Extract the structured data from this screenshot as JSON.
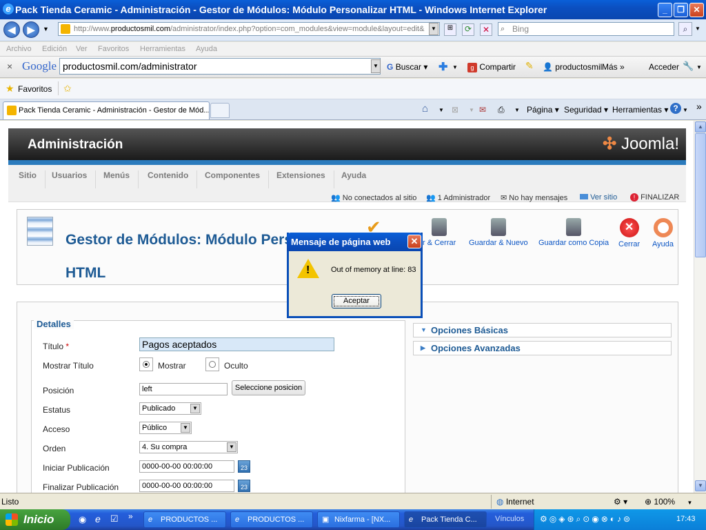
{
  "window": {
    "title": "Pack Tienda Ceramic - Administración - Gestor de Módulos: Módulo Personalizar HTML - Windows Internet Explorer",
    "url_prefix": "http://www.",
    "url_domain": "productosmil.com",
    "url_path": "/administrator/index.php?option=com_modules&view=module&layout=edit&",
    "bing_placeholder": "Bing"
  },
  "menu": {
    "archivo": "Archivo",
    "edicion": "Edición",
    "ver": "Ver",
    "favoritos": "Favoritos",
    "herramientas": "Herramientas",
    "ayuda": "Ayuda"
  },
  "google_toolbar": {
    "close": "×",
    "logo": "Google",
    "search_value": "productosmil.com/administrator",
    "buscar": "Buscar",
    "compartir": "Compartir",
    "user": "productosmil",
    "mas": "Más",
    "acceder": "Acceder"
  },
  "favorites_bar": {
    "favoritos": "Favoritos"
  },
  "tabs": {
    "active_tab": "Pack Tienda Ceramic - Administración - Gestor de Mód...",
    "pagina": "Página",
    "seguridad": "Seguridad",
    "herramientas": "Herramientas"
  },
  "joomla": {
    "header_title": "Administración",
    "logo": "Joomla!",
    "menu": [
      "Sitio",
      "Usuarios",
      "Menús",
      "Contenido",
      "Componentes",
      "Extensiones",
      "Ayuda"
    ],
    "status": {
      "no_conectados": "No conectados al sitio",
      "administrador": "1 Administrador",
      "mensajes": "No hay mensajes",
      "ver_sitio": "Ver sitio",
      "finalizar": "FINALIZAR"
    },
    "page_title": "Gestor de Módulos: Módulo Personalizar HTML",
    "toolbar": {
      "guardar_cerrar": "r & Cerrar",
      "guardar_nuevo": "Guardar & Nuevo",
      "guardar_copia": "Guardar como Copia",
      "cerrar": "Cerrar",
      "ayuda": "Ayuda"
    },
    "details": {
      "legend": "Detalles",
      "titulo_label": "Título",
      "required_mark": "*",
      "titulo_value": "Pagos aceptados",
      "mostrar_titulo_label": "Mostrar Título",
      "mostrar": "Mostrar",
      "oculto": "Oculto",
      "posicion_label": "Posición",
      "posicion_value": "left",
      "seleccione_posicion": "Seleccione posicion",
      "estatus_label": "Estatus",
      "estatus_value": "Publicado",
      "acceso_label": "Acceso",
      "acceso_value": "Público",
      "orden_label": "Orden",
      "orden_value": "4. Su compra",
      "iniciar_label": "Iniciar Publicación",
      "iniciar_value": "0000-00-00 00:00:00",
      "finalizar_label": "Finalizar Publicación",
      "finalizar_value": "0000-00-00 00:00:00",
      "cal_day": "23"
    },
    "options": {
      "basicas": "Opciones Básicas",
      "avanzadas": "Opciones Avanzadas"
    }
  },
  "dialog": {
    "title": "Mensaje de página web",
    "message": "Out of memory at line: 83",
    "button": "Aceptar"
  },
  "statusbar": {
    "left": "Listo",
    "zone": "Internet",
    "zoom": "100%"
  },
  "taskbar": {
    "start": "Inicio",
    "tasks": [
      "PRODUCTOS ...",
      "PRODUCTOS ...",
      "Nixfarma - [NX...",
      "Pack Tienda C..."
    ],
    "vinculos": "Vínculos",
    "clock": "17:43"
  }
}
